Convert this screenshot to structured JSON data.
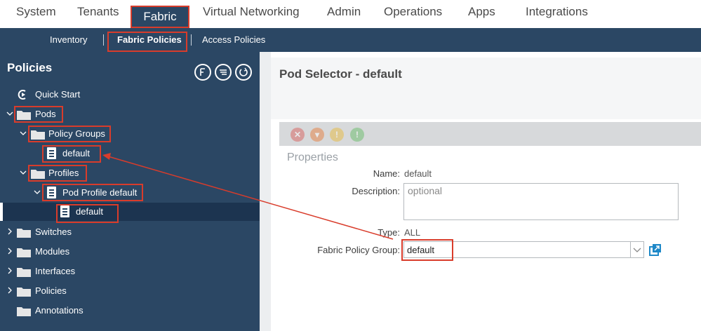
{
  "topnav": {
    "tabs": [
      {
        "label": "System"
      },
      {
        "label": "Tenants"
      },
      {
        "label": "Fabric"
      },
      {
        "label": "Virtual Networking"
      },
      {
        "label": "Admin"
      },
      {
        "label": "Operations"
      },
      {
        "label": "Apps"
      },
      {
        "label": "Integrations"
      }
    ]
  },
  "subnav": {
    "items": [
      {
        "label": "Inventory"
      },
      {
        "label": "Fabric Policies"
      },
      {
        "label": "Access Policies"
      }
    ]
  },
  "sidebar": {
    "title": "Policies",
    "tree": [
      {
        "label": "Quick Start"
      },
      {
        "label": "Pods"
      },
      {
        "label": "Policy Groups"
      },
      {
        "label": "default"
      },
      {
        "label": "Profiles"
      },
      {
        "label": "Pod Profile default"
      },
      {
        "label": "default"
      },
      {
        "label": "Switches"
      },
      {
        "label": "Modules"
      },
      {
        "label": "Interfaces"
      },
      {
        "label": "Policies"
      },
      {
        "label": "Annotations"
      }
    ]
  },
  "content": {
    "title": "Pod Selector - default",
    "section": "Properties",
    "fields": {
      "name_label": "Name:",
      "name_value": "default",
      "description_label": "Description:",
      "description_placeholder": "optional",
      "type_label": "Type:",
      "type_value": "ALL",
      "policy_group_label": "Fabric Policy Group:",
      "policy_group_value": "default"
    }
  },
  "colors": {
    "nav_bg": "#2b4764",
    "highlight": "#d93c2b",
    "link_icon": "#1e88c8"
  }
}
